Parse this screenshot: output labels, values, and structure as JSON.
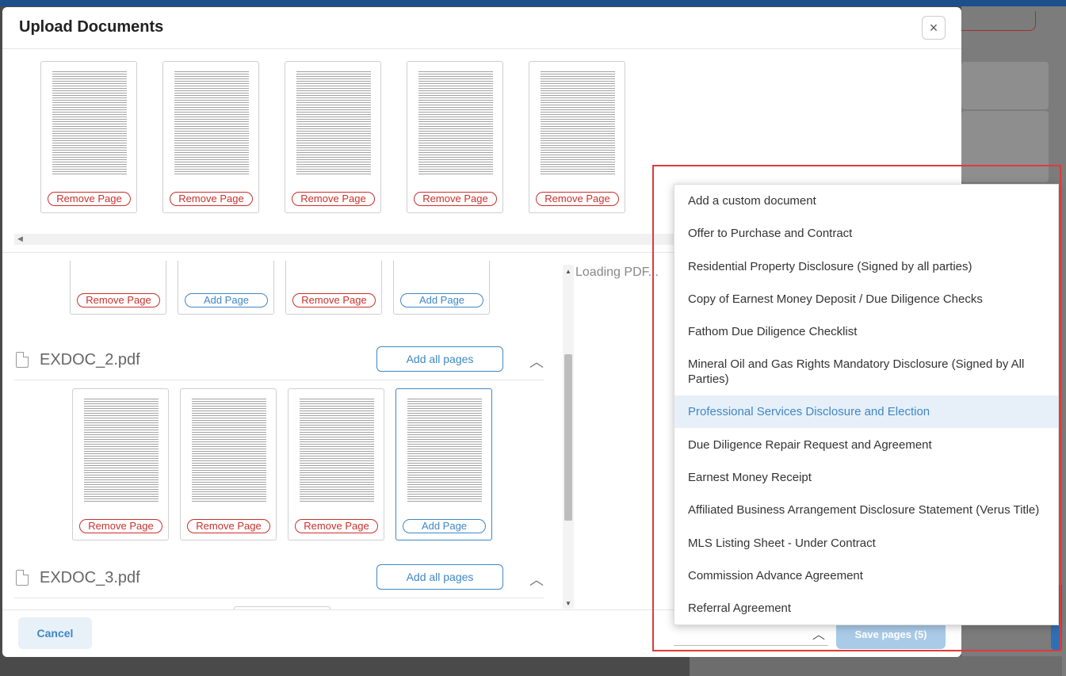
{
  "modal": {
    "title": "Upload Documents",
    "close_icon": "×"
  },
  "top_strip": {
    "pages": [
      {
        "action": "Remove Page"
      },
      {
        "action": "Remove Page"
      },
      {
        "action": "Remove Page"
      },
      {
        "action": "Remove Page"
      },
      {
        "action": "Remove Page"
      }
    ],
    "scroll_left_icon": "◀"
  },
  "lower": {
    "prev_doc_pages": [
      {
        "action": "Remove Page",
        "kind": "remove"
      },
      {
        "action": "Add Page",
        "kind": "add"
      },
      {
        "action": "Remove Page",
        "kind": "remove"
      },
      {
        "action": "Add Page",
        "kind": "add"
      }
    ],
    "docs": [
      {
        "name": "EXDOC_2.pdf",
        "add_all_label": "Add all pages",
        "pages": [
          {
            "action": "Remove Page",
            "kind": "remove"
          },
          {
            "action": "Remove Page",
            "kind": "remove"
          },
          {
            "action": "Remove Page",
            "kind": "remove"
          },
          {
            "action": "Add Page",
            "kind": "add"
          }
        ]
      },
      {
        "name": "EXDOC_3.pdf",
        "add_all_label": "Add all pages"
      }
    ],
    "chevron_up_icon": "︿",
    "scroll_up_icon": "▲",
    "scroll_down_icon": "▼"
  },
  "preview": {
    "loading_text": "Loading PDF..."
  },
  "footer": {
    "cancel_label": "Cancel",
    "save_label": "Save pages (5)",
    "select_chevron_icon": "︿"
  },
  "dropdown": {
    "options": [
      "Add a custom document",
      "Offer to Purchase and Contract",
      "Residential Property Disclosure (Signed by all parties)",
      "Copy of Earnest Money Deposit / Due Diligence Checks",
      "Fathom Due Diligence Checklist",
      "Mineral Oil and Gas Rights Mandatory Disclosure (Signed by All Parties)",
      "Professional Services Disclosure and Election",
      "Due Diligence Repair Request and Agreement",
      "Earnest Money Receipt",
      "Affiliated Business Arrangement Disclosure Statement (Verus Title)",
      "MLS Listing Sheet - Under Contract",
      "Commission Advance Agreement",
      "Referral Agreement"
    ],
    "highlighted_option": "Professional Services Disclosure and Election"
  }
}
